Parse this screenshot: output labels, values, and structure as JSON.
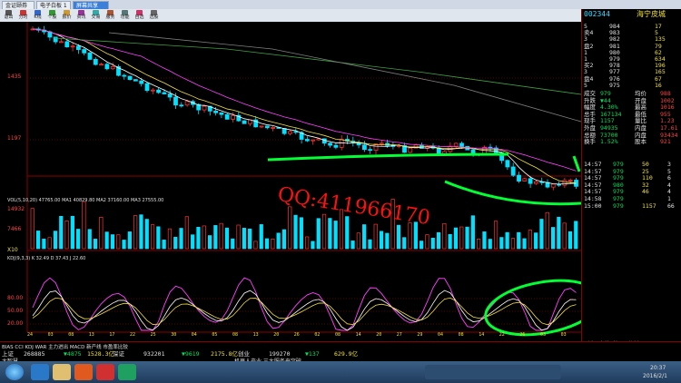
{
  "tabs": [
    {
      "label": "金证颐券"
    },
    {
      "label": "电子白板 1"
    },
    {
      "label": "屏幕共享"
    }
  ],
  "toolbar": [
    {
      "label": "退出",
      "icon": "back-icon"
    },
    {
      "label": "分时",
      "icon": "timeshare-icon"
    },
    {
      "label": "K线",
      "icon": "kline-icon"
    },
    {
      "label": "个股",
      "icon": "stock-icon"
    },
    {
      "label": "报价",
      "icon": "quote-icon"
    },
    {
      "label": "资讯",
      "icon": "news-icon"
    },
    {
      "label": "交易",
      "icon": "trade-icon"
    },
    {
      "label": "服务",
      "icon": "service-icon"
    },
    {
      "label": "功能",
      "icon": "function-icon"
    },
    {
      "label": "自选",
      "icon": "favorite-icon"
    },
    {
      "label": "选股",
      "icon": "picker-icon"
    }
  ],
  "main_chart": {
    "price_labels": [
      "1435",
      "1197"
    ],
    "watermark": "QQ:411966170"
  },
  "volume_panel": {
    "header": "VOL(5,10,20)  47765.00 MA1 40829.80 MA2 37160.00 MA3 27555.00",
    "labels": [
      "14932",
      "7466",
      "X10"
    ]
  },
  "kdj_panel": {
    "header": "KDJ(9,3,3) K 32.49 D 37.43 J 22.60",
    "labels": [
      "80.00",
      "50.00",
      "20.00"
    ]
  },
  "date_axis": [
    "24",
    "03",
    "08",
    "13",
    "17",
    "22",
    "25",
    "30",
    "04",
    "05",
    "08",
    "13",
    "20",
    "26",
    "02",
    "08",
    "14",
    "20",
    "27",
    "29",
    "04",
    "08",
    "14",
    "22",
    "26",
    "03",
    "03"
  ],
  "indicator_tabs": "BIAS CCI KDJ WAR 主力进出 MACD 新产线 市盈率比较",
  "quote": {
    "code": "002344",
    "name": "海宁皮城",
    "order_book": [
      {
        "label": "5",
        "price": "984",
        "vol": "17"
      },
      {
        "label": "卖4",
        "price": "983",
        "vol": "5"
      },
      {
        "label": "3",
        "price": "982",
        "vol": "135"
      },
      {
        "label": "盘2",
        "price": "981",
        "vol": "79"
      },
      {
        "label": "1",
        "price": "980",
        "vol": "62"
      },
      {
        "label": "1",
        "price": "979",
        "vol": "634"
      },
      {
        "label": "买2",
        "price": "978",
        "vol": "196"
      },
      {
        "label": "3",
        "price": "977",
        "vol": "165"
      },
      {
        "label": "盘4",
        "price": "976",
        "vol": "67"
      },
      {
        "label": "5",
        "price": "975",
        "vol": "16"
      }
    ],
    "stats": [
      {
        "k": "成交",
        "v": "979",
        "k2": "均价",
        "v2": "988"
      },
      {
        "k": "升跌",
        "v": "▼44",
        "k2": "开盘",
        "v2": "1002"
      },
      {
        "k": "幅度",
        "v": "4.30%",
        "k2": "最高",
        "v2": "1016"
      },
      {
        "k": "总手",
        "v": "167134",
        "k2": "最低",
        "v2": "955"
      },
      {
        "k": "现手",
        "v": "1157",
        "k2": "量比",
        "v2": "1.23"
      },
      {
        "k": "外盘",
        "v": "94935",
        "k2": "内盘",
        "v2": "17.61"
      },
      {
        "k": "总额",
        "v": "73700",
        "k2": "内盘",
        "v2": "93434"
      },
      {
        "k": "换手",
        "v": "1.52%",
        "k2": "股本",
        "v2": "921"
      }
    ],
    "ticks": [
      {
        "t": "14:57",
        "p": "979",
        "v": "50",
        "n": "3"
      },
      {
        "t": "14:57",
        "p": "979",
        "v": "25",
        "n": "5"
      },
      {
        "t": "14:57",
        "p": "979",
        "v": "110",
        "n": "6"
      },
      {
        "t": "14:57",
        "p": "980",
        "v": "32",
        "n": "4"
      },
      {
        "t": "14:57",
        "p": "979",
        "v": "46",
        "n": "4"
      },
      {
        "t": "14:58",
        "p": "979",
        "v": "",
        "n": "1"
      },
      {
        "t": "15:00",
        "p": "979",
        "v": "1157",
        "n": "66"
      }
    ],
    "tabs": [
      "财务",
      "走势",
      "筹码",
      "分析"
    ]
  },
  "bottom": {
    "row1": [
      "上证",
      "268885",
      "▼4875",
      "1528.3亿",
      "深证",
      "932201",
      "▼9619",
      "2175.8亿",
      "创业",
      "199270",
      "▼137",
      "629.9亿"
    ],
    "row2_label": "大智慧",
    "ticker": "机器人产业 三大服务来突破"
  },
  "taskbar": {
    "time": "20:37",
    "date": "2016/2/1"
  },
  "colors": {
    "up": "#ff3333",
    "down": "#00e0ff",
    "annotation": "#00ff33",
    "watermark": "#ff0000"
  }
}
